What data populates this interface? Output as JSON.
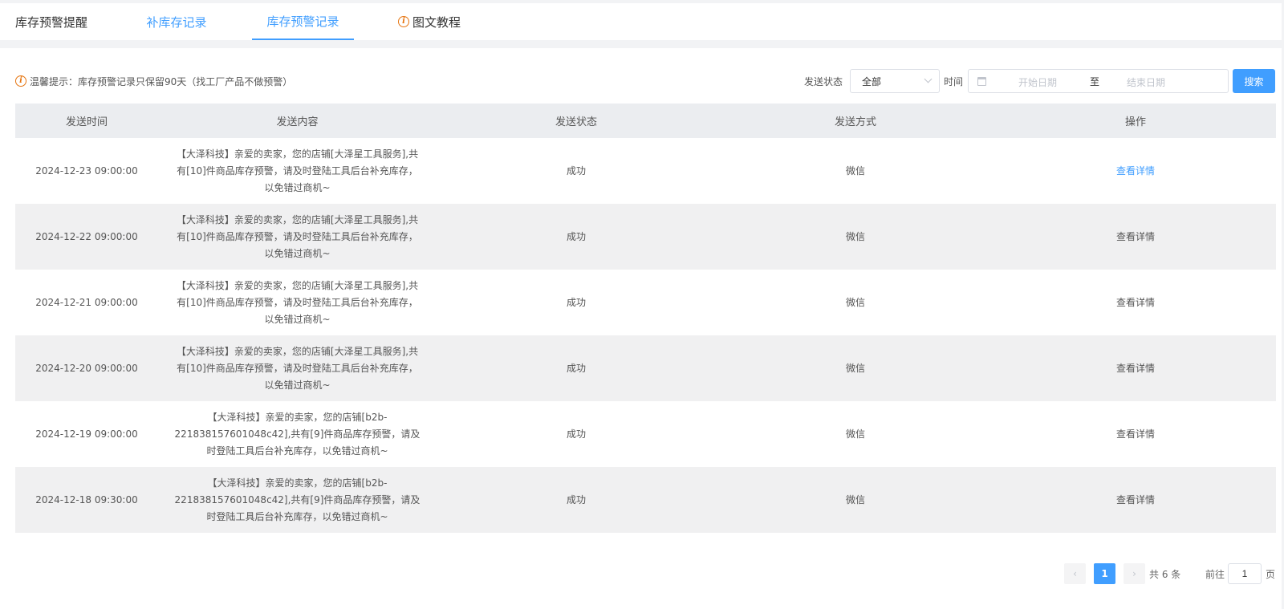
{
  "tabs": {
    "title": "库存预警提醒",
    "restock": "补库存记录",
    "warning_records": "库存预警记录",
    "tutorial": "图文教程"
  },
  "hint": "温馨提示：库存预警记录只保留90天（找工厂产品不做预警）",
  "filters": {
    "status_label": "发送状态",
    "status_value": "全部",
    "time_label": "时间",
    "start_placeholder": "开始日期",
    "separator": "至",
    "end_placeholder": "结束日期",
    "search_label": "搜索"
  },
  "table": {
    "headers": [
      "发送时间",
      "发送内容",
      "发送状态",
      "发送方式",
      "操作"
    ],
    "rows": [
      {
        "time": "2024-12-23 09:00:00",
        "content": "【大泽科技】亲爱的卖家，您的店铺[大泽星工具服务],共有[10]件商品库存预警，请及时登陆工具后台补充库存，以免错过商机~",
        "status": "成功",
        "method": "微信",
        "action": "查看详情"
      },
      {
        "time": "2024-12-22 09:00:00",
        "content": "【大泽科技】亲爱的卖家，您的店铺[大泽星工具服务],共有[10]件商品库存预警，请及时登陆工具后台补充库存，以免错过商机~",
        "status": "成功",
        "method": "微信",
        "action": "查看详情"
      },
      {
        "time": "2024-12-21 09:00:00",
        "content": "【大泽科技】亲爱的卖家，您的店铺[大泽星工具服务],共有[10]件商品库存预警，请及时登陆工具后台补充库存，以免错过商机~",
        "status": "成功",
        "method": "微信",
        "action": "查看详情"
      },
      {
        "time": "2024-12-20 09:00:00",
        "content": "【大泽科技】亲爱的卖家，您的店铺[大泽星工具服务],共有[10]件商品库存预警，请及时登陆工具后台补充库存，以免错过商机~",
        "status": "成功",
        "method": "微信",
        "action": "查看详情"
      },
      {
        "time": "2024-12-19 09:00:00",
        "content": "【大泽科技】亲爱的卖家，您的店铺[b2b-221838157601048c42],共有[9]件商品库存预警，请及时登陆工具后台补充库存，以免错过商机~",
        "status": "成功",
        "method": "微信",
        "action": "查看详情"
      },
      {
        "time": "2024-12-18 09:30:00",
        "content": "【大泽科技】亲爱的卖家，您的店铺[b2b-221838157601048c42],共有[9]件商品库存预警，请及时登陆工具后台补充库存，以免错过商机~",
        "status": "成功",
        "method": "微信",
        "action": "查看详情"
      }
    ]
  },
  "pagination": {
    "prev": "‹",
    "current_page": "1",
    "next": "›",
    "total": "共 6 条",
    "goto_label": "前往",
    "goto_value": "1",
    "page_unit": "页"
  },
  "colors": {
    "accent": "#409eff",
    "warning": "#e6740f"
  },
  "icons": [
    "info-icon",
    "calendar-icon",
    "chevron-down-icon",
    "chevron-left-icon",
    "chevron-right-icon"
  ]
}
